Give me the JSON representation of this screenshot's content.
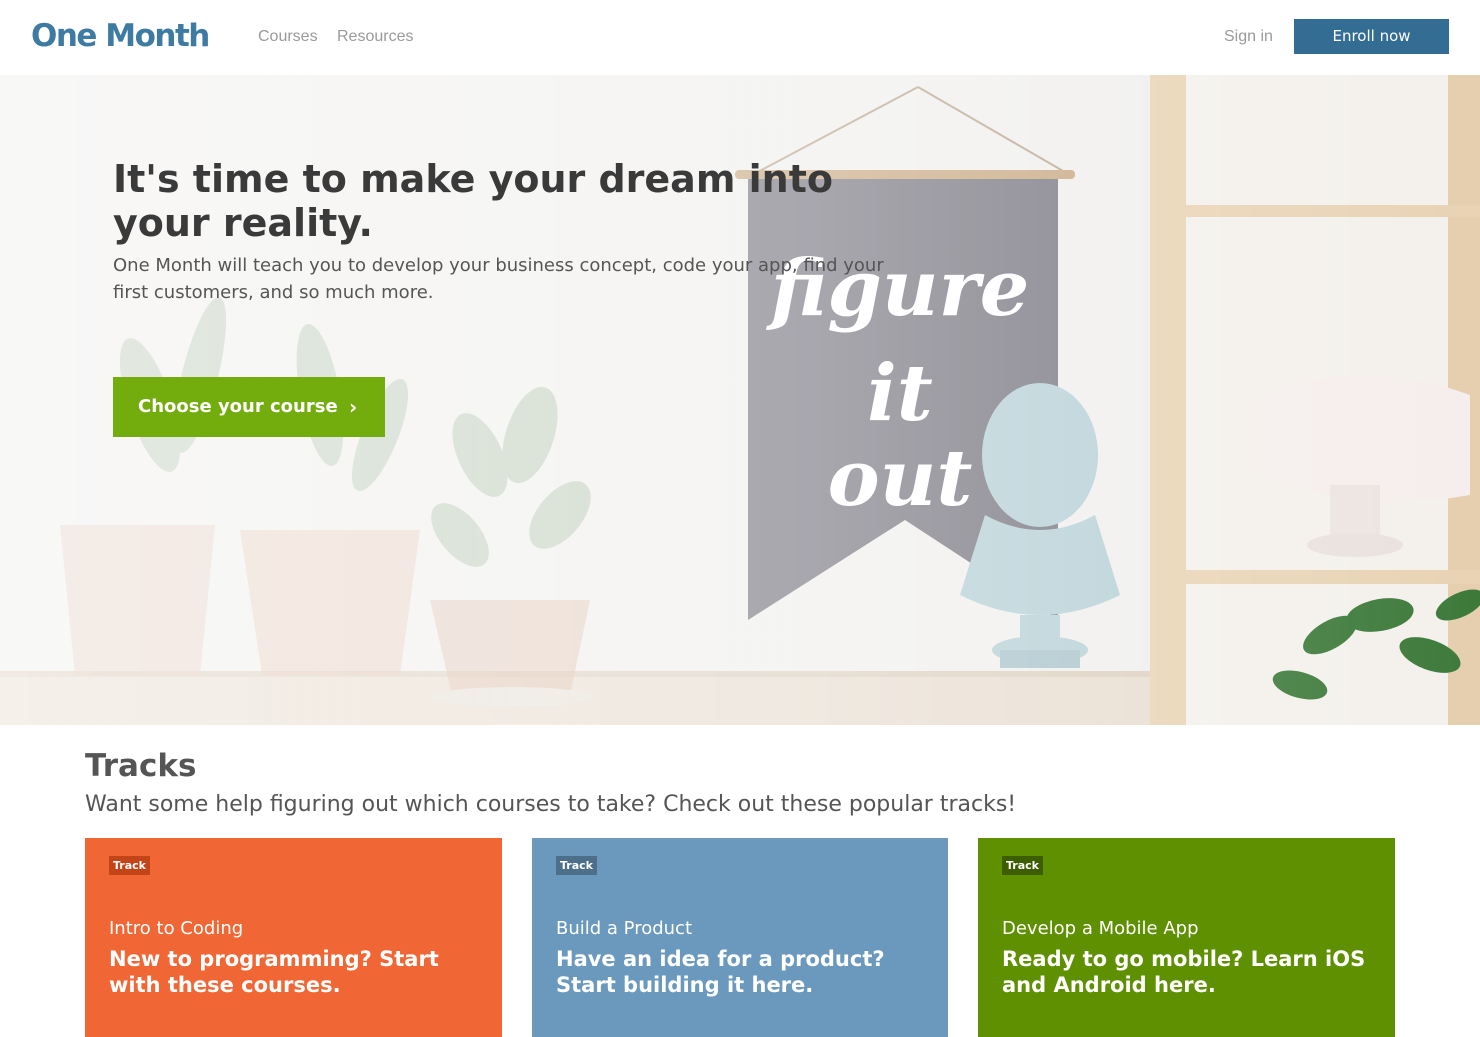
{
  "nav": {
    "logo": "One Month",
    "links": [
      {
        "label": "Courses"
      },
      {
        "label": "Resources"
      }
    ],
    "sign_in": "Sign in",
    "enroll": "Enroll now"
  },
  "hero": {
    "title": "It's time to make your dream into your reality.",
    "subtitle": "One Month will teach you to develop your business concept, code your app, find your first customers, and so much more.",
    "cta_label": "Choose your course",
    "cta_icon": "chevron-right-icon",
    "banner_text": [
      "figure",
      "it",
      "out"
    ]
  },
  "tracks": {
    "heading": "Tracks",
    "subheading": "Want some help figuring out which courses to take? Check out these popular tracks!",
    "cards": [
      {
        "badge": "Track",
        "title": "Intro to Coding",
        "description": "New to programming? Start with these courses.",
        "color": "#f06634"
      },
      {
        "badge": "Track",
        "title": "Build a Product",
        "description": "Have an idea for a product? Start building it here.",
        "color": "#6a99bd"
      },
      {
        "badge": "Track",
        "title": "Develop a Mobile App",
        "description": "Ready to go mobile? Learn iOS and Android here.",
        "color": "#5e9001"
      }
    ]
  },
  "colors": {
    "brand_blue": "#336d93",
    "cta_green": "#73ac0d"
  }
}
